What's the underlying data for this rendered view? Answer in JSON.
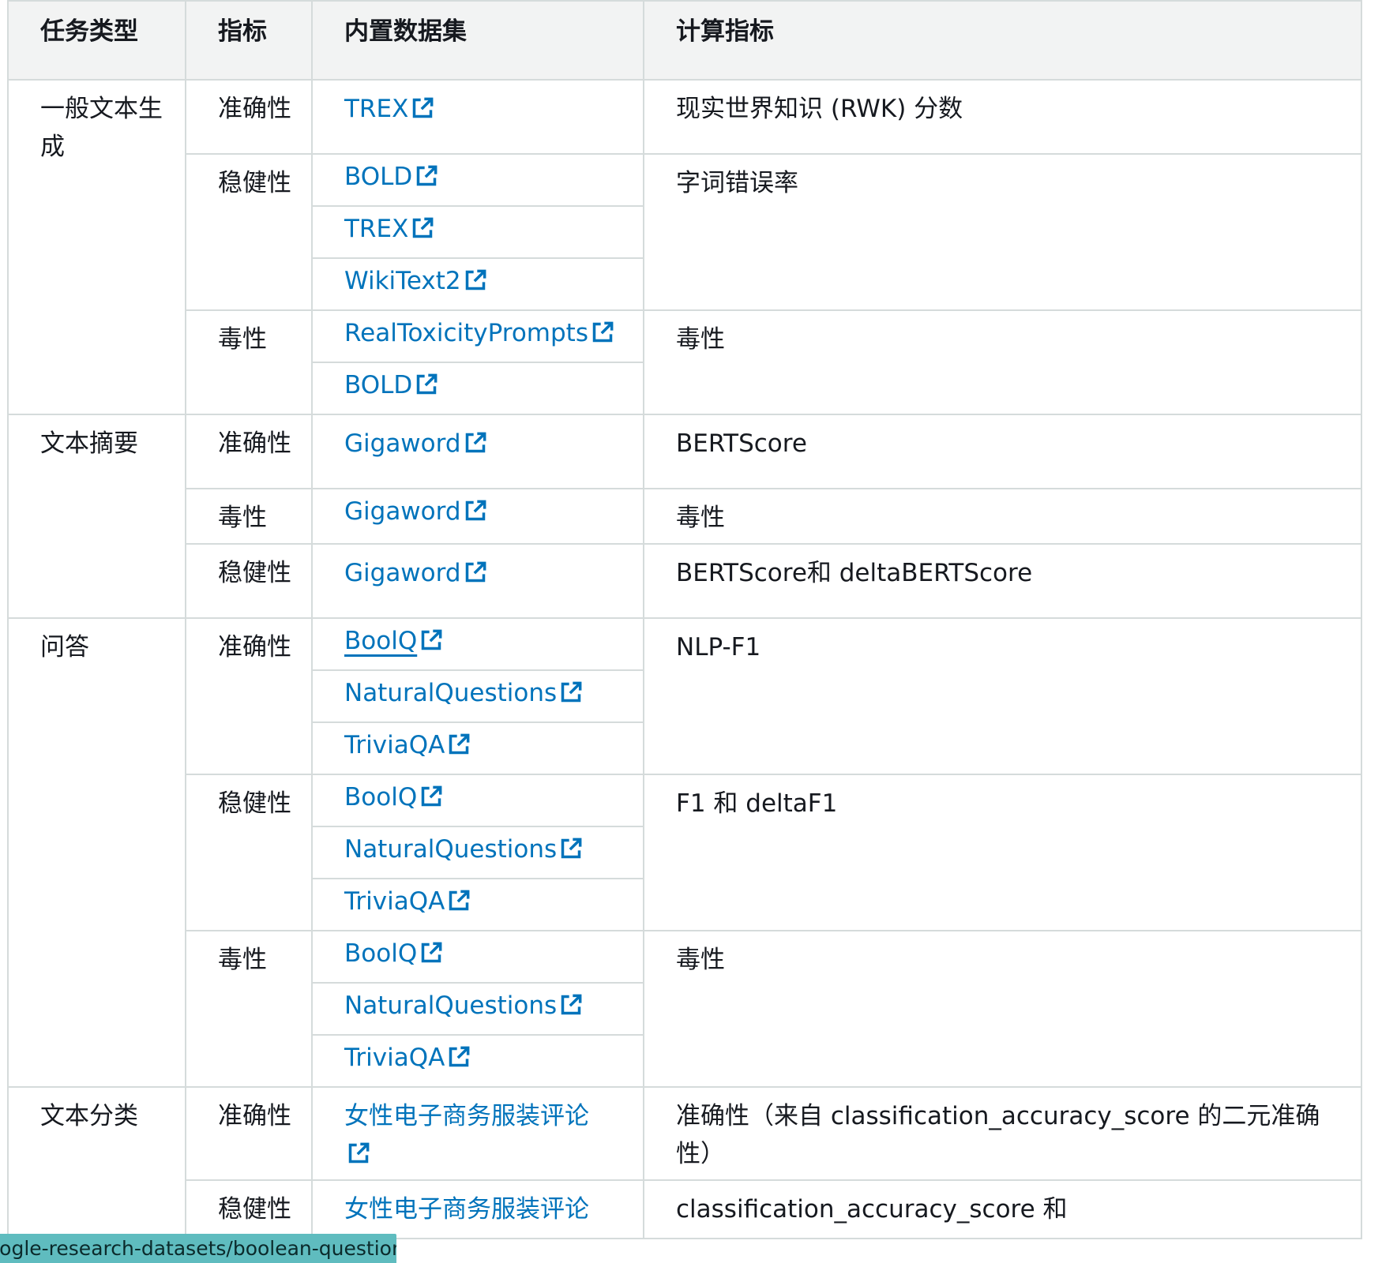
{
  "headers": {
    "task_type": "任务类型",
    "metric": "指标",
    "builtin_dataset": "内置数据集",
    "computed_metric": "计算指标"
  },
  "rows": {
    "gen": {
      "task": "一般文本生成",
      "acc": {
        "metric": "准确性",
        "datasets": [
          "TREX"
        ],
        "computed": "现实世界知识 (RWK) 分数"
      },
      "rob": {
        "metric": "稳健性",
        "datasets": [
          "BOLD",
          "TREX",
          "WikiText2"
        ],
        "computed": "字词错误率"
      },
      "tox": {
        "metric": "毒性",
        "datasets": [
          "RealToxicityPrompts",
          "BOLD"
        ],
        "computed": "毒性"
      }
    },
    "sum": {
      "task": "文本摘要",
      "acc": {
        "metric": "准确性",
        "datasets": [
          "Gigaword"
        ],
        "computed": "BERTScore"
      },
      "tox": {
        "metric": "毒性",
        "datasets": [
          "Gigaword"
        ],
        "computed": "毒性"
      },
      "rob": {
        "metric": "稳健性",
        "datasets": [
          "Gigaword"
        ],
        "computed": "BERTScore和 deltaBERTScore"
      }
    },
    "qa": {
      "task": "问答",
      "acc": {
        "metric": "准确性",
        "datasets": [
          "BoolQ",
          "NaturalQuestions",
          "TriviaQA"
        ],
        "computed": "NLP-F1"
      },
      "rob": {
        "metric": "稳健性",
        "datasets": [
          "BoolQ",
          "NaturalQuestions",
          "TriviaQA"
        ],
        "computed": "F1 和 deltaF1"
      },
      "tox": {
        "metric": "毒性",
        "datasets": [
          "BoolQ",
          "NaturalQuestions",
          "TriviaQA"
        ],
        "computed": "毒性"
      }
    },
    "cls": {
      "task": "文本分类",
      "acc": {
        "metric": "准确性",
        "datasets": [
          "女性电子商务服装评论"
        ],
        "computed": "准确性（来自 classification_accuracy_score 的二元准确性）"
      },
      "rob": {
        "metric": "稳健性",
        "datasets": [
          "女性电子商务服装评论"
        ],
        "computed": "classification_accuracy_score 和"
      }
    }
  },
  "status_bar": {
    "url": "google-research-datasets/boolean-questions"
  },
  "colors": {
    "link": "#0073bb",
    "header_bg": "#f2f3f3",
    "border": "#d5dbdb",
    "status_bg": "#5fbcbf"
  }
}
